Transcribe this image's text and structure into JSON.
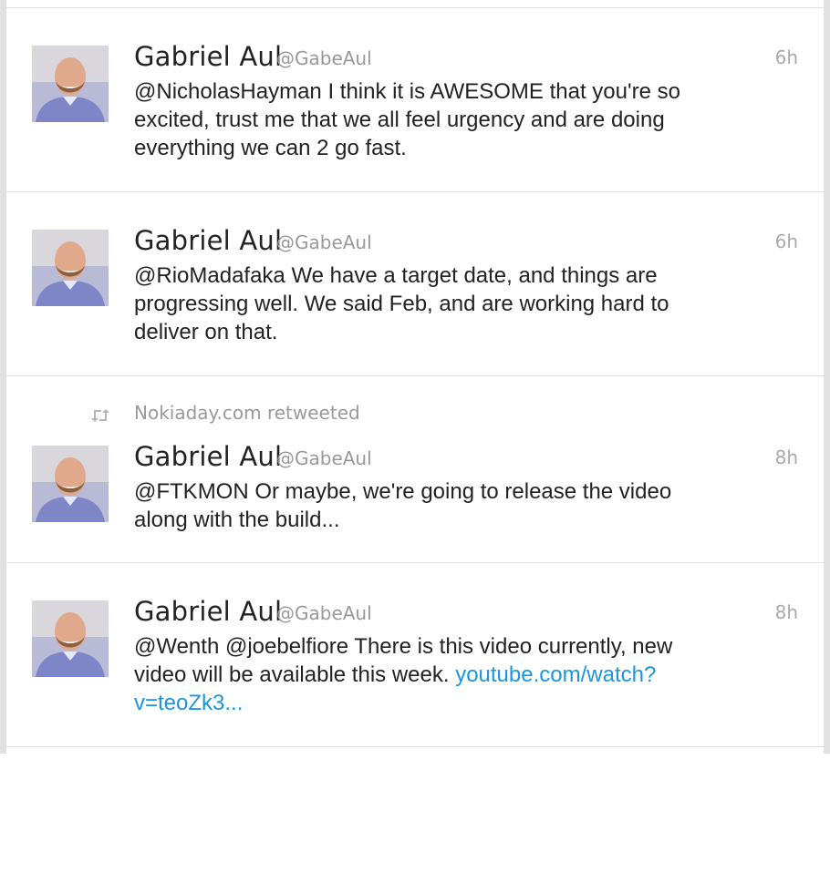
{
  "tweets": [
    {
      "name": "Gabriel Aul",
      "handle": "@GabeAul",
      "time": "6h",
      "text": "@NicholasHayman I think it is AWESOME that you're so excited, trust me that we all feel urgency and are doing everything we can 2 go fast."
    },
    {
      "name": "Gabriel Aul",
      "handle": "@GabeAul",
      "time": "6h",
      "text": "@RioMadafaka We have a target date, and things are progressing well. We said Feb, and are working hard to deliver on that."
    },
    {
      "retweeted_by": "Nokiaday.com retweeted",
      "name": "Gabriel Aul",
      "handle": "@GabeAul",
      "time": "8h",
      "text": "@FTKMON Or maybe, we're going to release the video along with the build..."
    },
    {
      "name": "Gabriel Aul",
      "handle": "@GabeAul",
      "time": "8h",
      "text_before_link": "@Wenth @joebelfiore There is this video currently, new video will be available this week. ",
      "link": "youtube.com/watch?v=teoZk3..."
    }
  ],
  "colors": {
    "link": "#1b95e0",
    "muted": "#999999",
    "divider": "#e1e1e1"
  }
}
